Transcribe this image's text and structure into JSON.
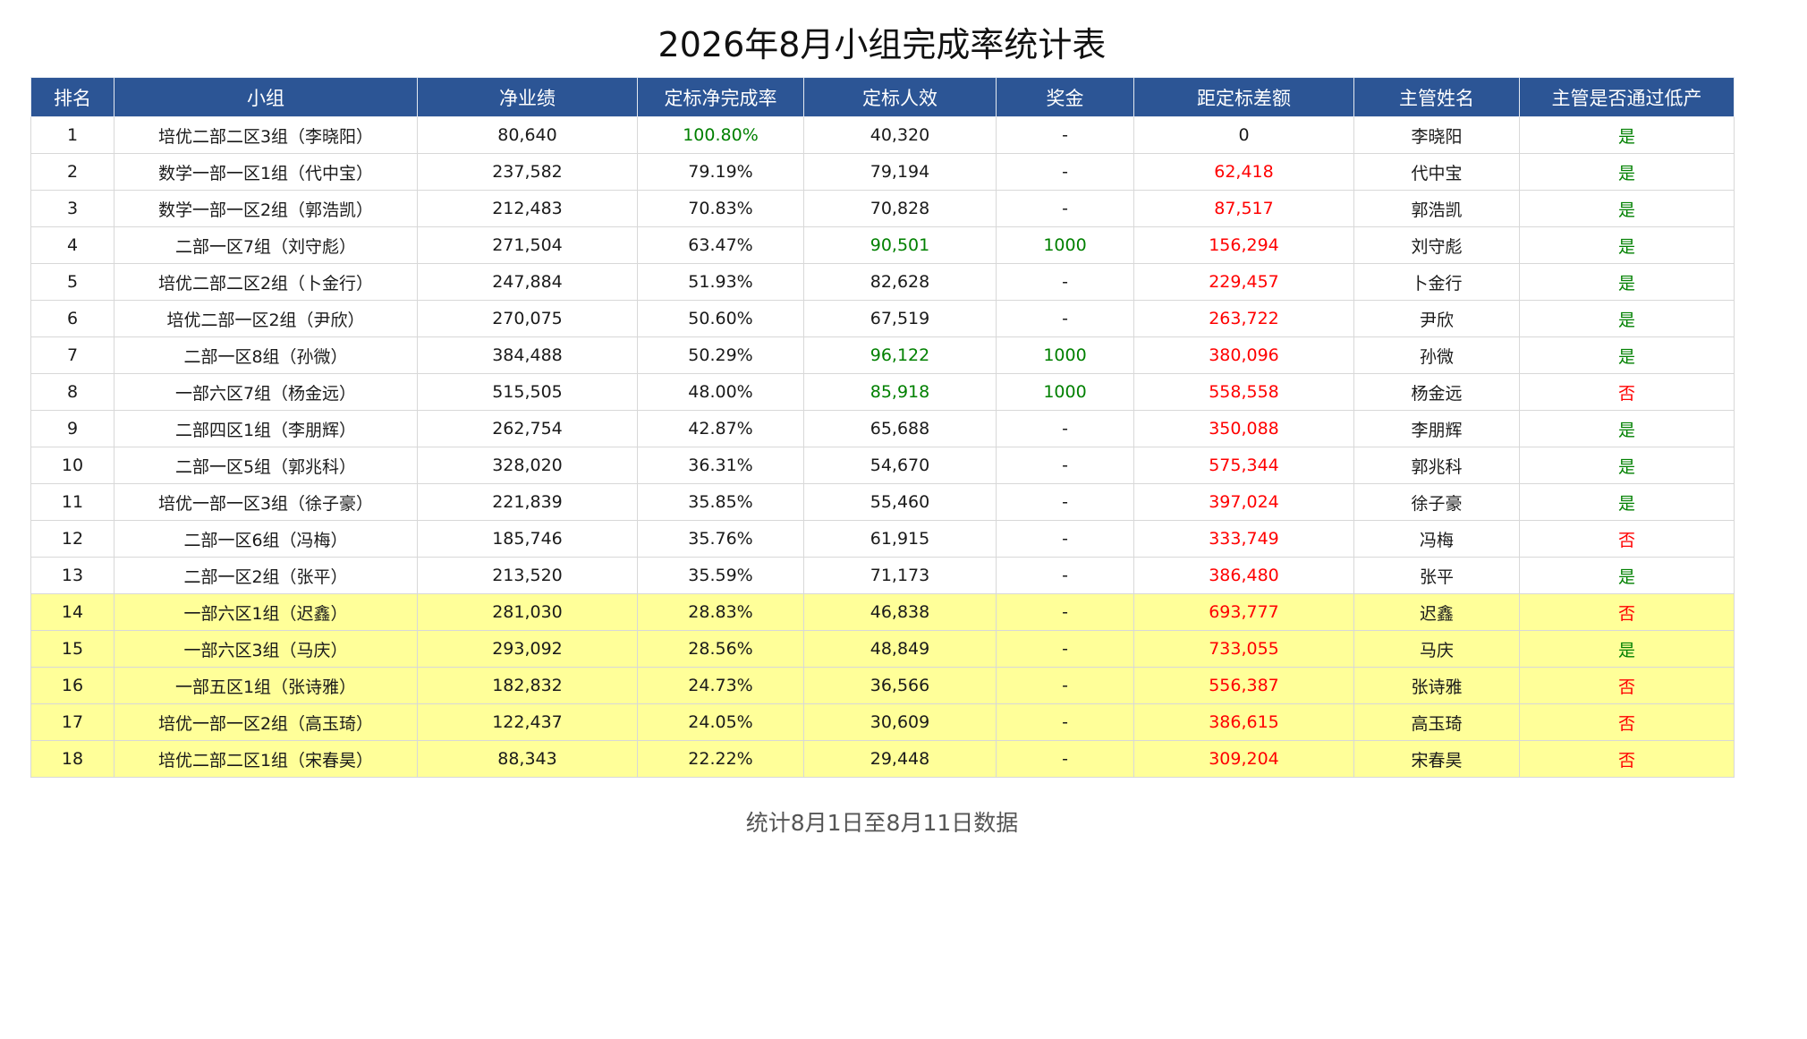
{
  "title": "2026年8月小组完成率统计表",
  "columns": [
    "排名",
    "小组",
    "净业绩",
    "定标净完成率",
    "定标人效",
    "奖金",
    "距定标差额",
    "主管姓名",
    "主管是否通过低产"
  ],
  "colors": {
    "header_bg": "#2c5595",
    "highlight_row": "#ffff99",
    "positive": "#008000",
    "negative": "#ff0000"
  },
  "rows": [
    {
      "rank": "1",
      "group": "培优二部二区3组（李晓阳）",
      "net": "80,640",
      "rate": "100.80%",
      "per_capita": "40,320",
      "bonus": "-",
      "gap": "0",
      "manager": "李晓阳",
      "passed": "是",
      "highlight": false
    },
    {
      "rank": "2",
      "group": "数学一部一区1组（代中宝）",
      "net": "237,582",
      "rate": "79.19%",
      "per_capita": "79,194",
      "bonus": "-",
      "gap": "62,418",
      "manager": "代中宝",
      "passed": "是",
      "highlight": false
    },
    {
      "rank": "3",
      "group": "数学一部一区2组（郭浩凯）",
      "net": "212,483",
      "rate": "70.83%",
      "per_capita": "70,828",
      "bonus": "-",
      "gap": "87,517",
      "manager": "郭浩凯",
      "passed": "是",
      "highlight": false
    },
    {
      "rank": "4",
      "group": "二部一区7组（刘守彪）",
      "net": "271,504",
      "rate": "63.47%",
      "per_capita": "90,501",
      "bonus": "1000",
      "gap": "156,294",
      "manager": "刘守彪",
      "passed": "是",
      "highlight": false
    },
    {
      "rank": "5",
      "group": "培优二部二区2组（卜金行）",
      "net": "247,884",
      "rate": "51.93%",
      "per_capita": "82,628",
      "bonus": "-",
      "gap": "229,457",
      "manager": "卜金行",
      "passed": "是",
      "highlight": false
    },
    {
      "rank": "6",
      "group": "培优二部一区2组（尹欣）",
      "net": "270,075",
      "rate": "50.60%",
      "per_capita": "67,519",
      "bonus": "-",
      "gap": "263,722",
      "manager": "尹欣",
      "passed": "是",
      "highlight": false
    },
    {
      "rank": "7",
      "group": "二部一区8组（孙微）",
      "net": "384,488",
      "rate": "50.29%",
      "per_capita": "96,122",
      "bonus": "1000",
      "gap": "380,096",
      "manager": "孙微",
      "passed": "是",
      "highlight": false
    },
    {
      "rank": "8",
      "group": "一部六区7组（杨金远）",
      "net": "515,505",
      "rate": "48.00%",
      "per_capita": "85,918",
      "bonus": "1000",
      "gap": "558,558",
      "manager": "杨金远",
      "passed": "否",
      "highlight": false
    },
    {
      "rank": "9",
      "group": "二部四区1组（李朋辉）",
      "net": "262,754",
      "rate": "42.87%",
      "per_capita": "65,688",
      "bonus": "-",
      "gap": "350,088",
      "manager": "李朋辉",
      "passed": "是",
      "highlight": false
    },
    {
      "rank": "10",
      "group": "二部一区5组（郭兆科）",
      "net": "328,020",
      "rate": "36.31%",
      "per_capita": "54,670",
      "bonus": "-",
      "gap": "575,344",
      "manager": "郭兆科",
      "passed": "是",
      "highlight": false
    },
    {
      "rank": "11",
      "group": "培优一部一区3组（徐子豪）",
      "net": "221,839",
      "rate": "35.85%",
      "per_capita": "55,460",
      "bonus": "-",
      "gap": "397,024",
      "manager": "徐子豪",
      "passed": "是",
      "highlight": false
    },
    {
      "rank": "12",
      "group": "二部一区6组（冯梅）",
      "net": "185,746",
      "rate": "35.76%",
      "per_capita": "61,915",
      "bonus": "-",
      "gap": "333,749",
      "manager": "冯梅",
      "passed": "否",
      "highlight": false
    },
    {
      "rank": "13",
      "group": "二部一区2组（张平）",
      "net": "213,520",
      "rate": "35.59%",
      "per_capita": "71,173",
      "bonus": "-",
      "gap": "386,480",
      "manager": "张平",
      "passed": "是",
      "highlight": false
    },
    {
      "rank": "14",
      "group": "一部六区1组（迟鑫）",
      "net": "281,030",
      "rate": "28.83%",
      "per_capita": "46,838",
      "bonus": "-",
      "gap": "693,777",
      "manager": "迟鑫",
      "passed": "否",
      "highlight": true
    },
    {
      "rank": "15",
      "group": "一部六区3组（马庆）",
      "net": "293,092",
      "rate": "28.56%",
      "per_capita": "48,849",
      "bonus": "-",
      "gap": "733,055",
      "manager": "马庆",
      "passed": "是",
      "highlight": true
    },
    {
      "rank": "16",
      "group": "一部五区1组（张诗雅）",
      "net": "182,832",
      "rate": "24.73%",
      "per_capita": "36,566",
      "bonus": "-",
      "gap": "556,387",
      "manager": "张诗雅",
      "passed": "否",
      "highlight": true
    },
    {
      "rank": "17",
      "group": "培优一部一区2组（高玉琦）",
      "net": "122,437",
      "rate": "24.05%",
      "per_capita": "30,609",
      "bonus": "-",
      "gap": "386,615",
      "manager": "高玉琦",
      "passed": "否",
      "highlight": true
    },
    {
      "rank": "18",
      "group": "培优二部二区1组（宋春昊）",
      "net": "88,343",
      "rate": "22.22%",
      "per_capita": "29,448",
      "bonus": "-",
      "gap": "309,204",
      "manager": "宋春昊",
      "passed": "否",
      "highlight": true
    }
  ],
  "footer": "统计8月1日至8月11日数据"
}
